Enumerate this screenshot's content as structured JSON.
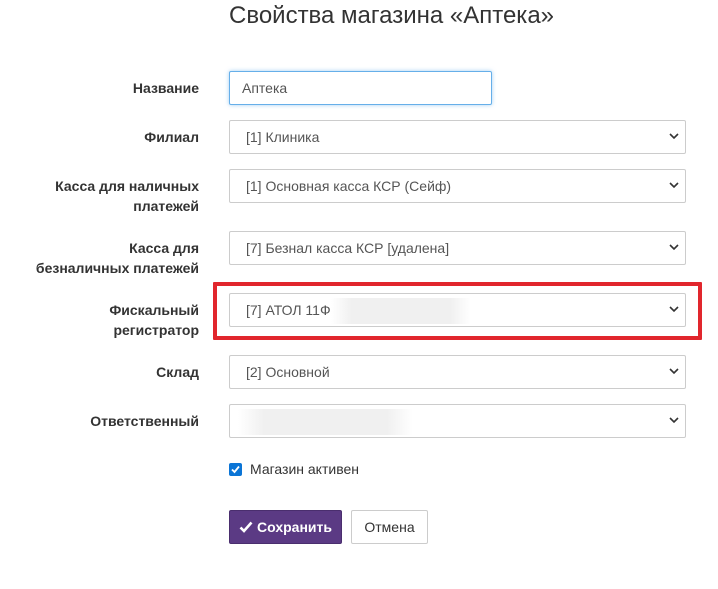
{
  "page": {
    "title": "Свойства магазина «Аптека»"
  },
  "fields": {
    "name": {
      "label": "Название",
      "value": "Аптека"
    },
    "branch": {
      "label": "Филиал",
      "value": "[1] Клиника"
    },
    "cash": {
      "label_line1": "Касса для наличных",
      "label_line2": "платежей",
      "value": "[1] Основная касса КСР (Сейф)"
    },
    "noncash": {
      "label_line1": "Касса для",
      "label_line2": "безналичных платежей",
      "value": "[7] Безнал касса КСР [удалена]"
    },
    "fiscal": {
      "label_line1": "Фискальный",
      "label_line2": "регистратор",
      "value": "[7] АТОЛ 11Ф"
    },
    "warehouse": {
      "label": "Склад",
      "value": "[2] Основной"
    },
    "responsible": {
      "label": "Ответственный",
      "value": ""
    }
  },
  "active_checkbox": {
    "label": "Магазин активен",
    "checked": true
  },
  "buttons": {
    "save": "Сохранить",
    "cancel": "Отмена"
  },
  "colors": {
    "highlight": "#e1262d",
    "primary": "#5b3a84",
    "checkbox": "#0b75d6",
    "focus": "#66afe9"
  }
}
